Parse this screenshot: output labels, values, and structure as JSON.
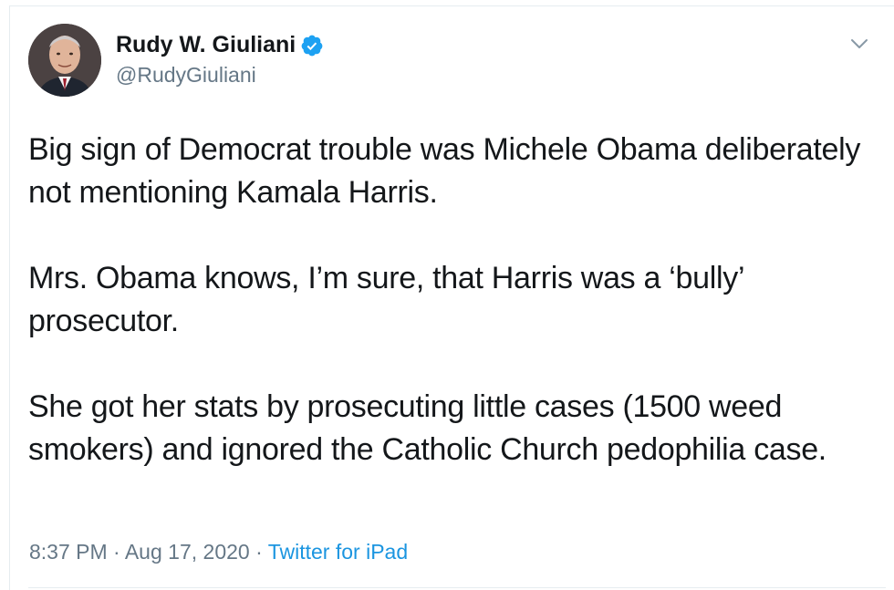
{
  "author": {
    "name": "Rudy W. Giuliani",
    "handle": "@RudyGiuliani",
    "verified": true,
    "verified_icon": "verified-badge-icon",
    "avatar_icon": "avatar-photo"
  },
  "tweet": {
    "paragraphs": [
      "Big sign of Democrat trouble was Michele Obama deliberately not mentioning Kamala Harris.",
      "Mrs. Obama knows, I’m sure, that Harris was a ‘bully’ prosecutor.",
      "She got her stats by prosecuting little cases (1500 weed smokers) and ignored the Catholic Church pedophilia case."
    ]
  },
  "meta": {
    "time": "8:37 PM",
    "separator": "·",
    "date": "Aug 17, 2020",
    "source": "Twitter for iPad"
  },
  "colors": {
    "text": "#14171a",
    "secondary": "#657786",
    "link": "#1b95e0",
    "verified": "#1da1f2",
    "divider": "#e6ecf0"
  },
  "menu": {
    "icon": "chevron-down-icon"
  }
}
